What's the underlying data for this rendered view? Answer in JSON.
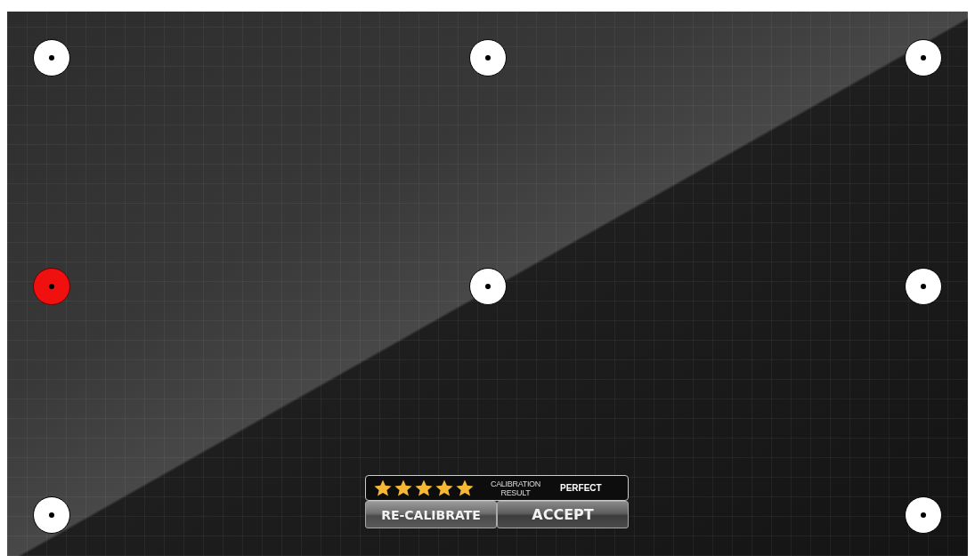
{
  "target_rows": [
    [
      {
        "selected": false
      },
      {
        "selected": false
      },
      {
        "selected": false
      }
    ],
    [
      {
        "selected": true
      },
      {
        "selected": false
      },
      {
        "selected": false
      }
    ],
    [
      {
        "selected": false
      },
      {
        "selected": false
      }
    ]
  ],
  "result": {
    "stars": 5,
    "label": "CALIBRATION RESULT",
    "value": "PERFECT"
  },
  "buttons": [
    "RE-CALIBRATE",
    "ACCEPT"
  ]
}
